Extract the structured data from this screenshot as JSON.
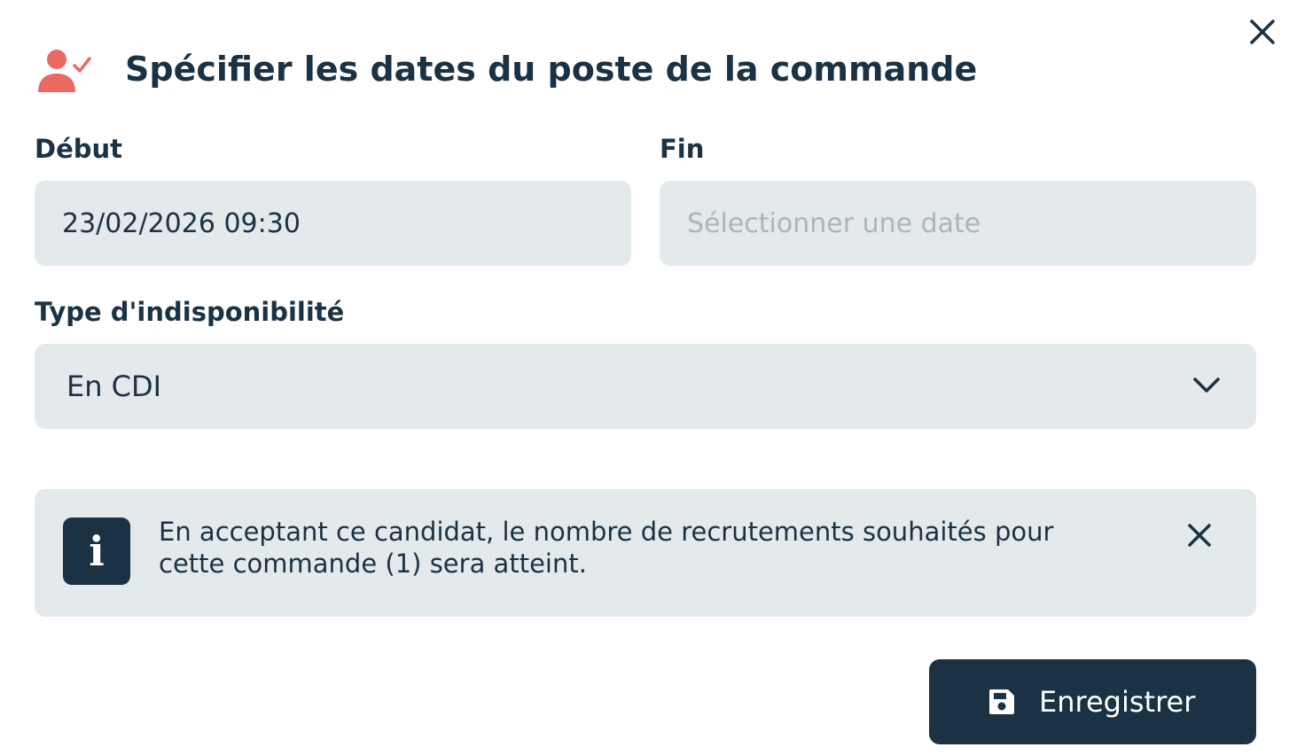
{
  "dialog": {
    "title": "Spécifier les dates du poste de la commande",
    "title_icon": "user-check-icon",
    "close_icon": "close-icon"
  },
  "form": {
    "start": {
      "label": "Début",
      "value": "23/02/2026 09:30"
    },
    "end": {
      "label": "Fin",
      "placeholder": "Sélectionner une date",
      "value": ""
    },
    "unavailability_type": {
      "label": "Type d'indisponibilité",
      "selected": "En CDI",
      "icon": "chevron-down-icon"
    }
  },
  "info": {
    "icon": "info-icon",
    "icon_glyph": "i",
    "message": "En acceptant ce candidat, le nombre de recrutements souhaités pour cette commande (1) sera atteint.",
    "close_icon": "close-icon"
  },
  "actions": {
    "save_label": "Enregistrer",
    "save_icon": "floppy-disk-icon"
  },
  "colors": {
    "primary": "#1a3244",
    "accent": "#ea6a63",
    "field_bg": "#e4e9ec",
    "placeholder": "#a9b6bf"
  }
}
